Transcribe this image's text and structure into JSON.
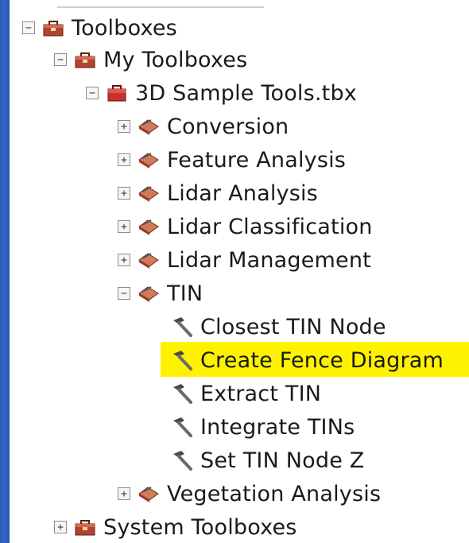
{
  "tree": {
    "toolboxes_label": "Toolboxes",
    "my_toolboxes_label": "My Toolboxes",
    "tbx_label": "3D Sample Tools.tbx",
    "conversion_label": "Conversion",
    "feature_analysis_label": "Feature Analysis",
    "lidar_analysis_label": "Lidar Analysis",
    "lidar_classification_label": "Lidar Classification",
    "lidar_management_label": "Lidar Management",
    "tin_label": "TIN",
    "tools": [
      {
        "label": "Closest TIN Node"
      },
      {
        "label": "Create Fence Diagram"
      },
      {
        "label": "Extract TIN"
      },
      {
        "label": "Integrate TINs"
      },
      {
        "label": "Set TIN Node Z"
      }
    ],
    "vegetation_label": "Vegetation Analysis",
    "system_toolboxes_label": "System Toolboxes",
    "expanded_symbol": "−",
    "collapsed_symbol": "+"
  },
  "colors": {
    "background": "#1f4fa6",
    "panel": "#ffffff",
    "highlight": "#fff200"
  }
}
